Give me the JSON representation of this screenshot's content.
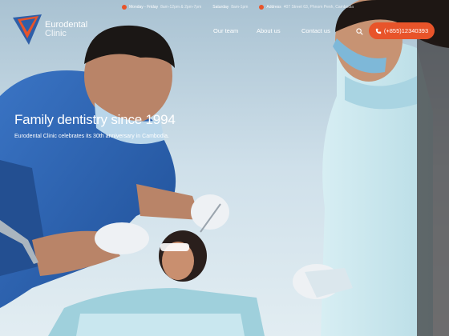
{
  "topbar": {
    "hours_weekday_label": "Monday - Friday",
    "hours_weekday_value": "8am-12pm & 2pm-7pm",
    "hours_saturday_label": "Saturday",
    "hours_saturday_value": "8am-1pm",
    "address_label": "Address",
    "address_value": "407 Street 63, Phnom Penh, Cambodia"
  },
  "header": {
    "logo_line1": "Eurodental",
    "logo_line2": "Clinic",
    "nav": [
      "Our team",
      "About us",
      "Contact us"
    ],
    "phone": "(+855)12340393"
  },
  "hero": {
    "title": "Family dentistry since 1994",
    "subtitle": "Eurodental Clinic celebrates its 30th anniversary in Cambodia."
  },
  "colors": {
    "accent": "#e8542a",
    "logo_blue": "#2f5fa8",
    "uniform_blue": "#2c63b3"
  }
}
